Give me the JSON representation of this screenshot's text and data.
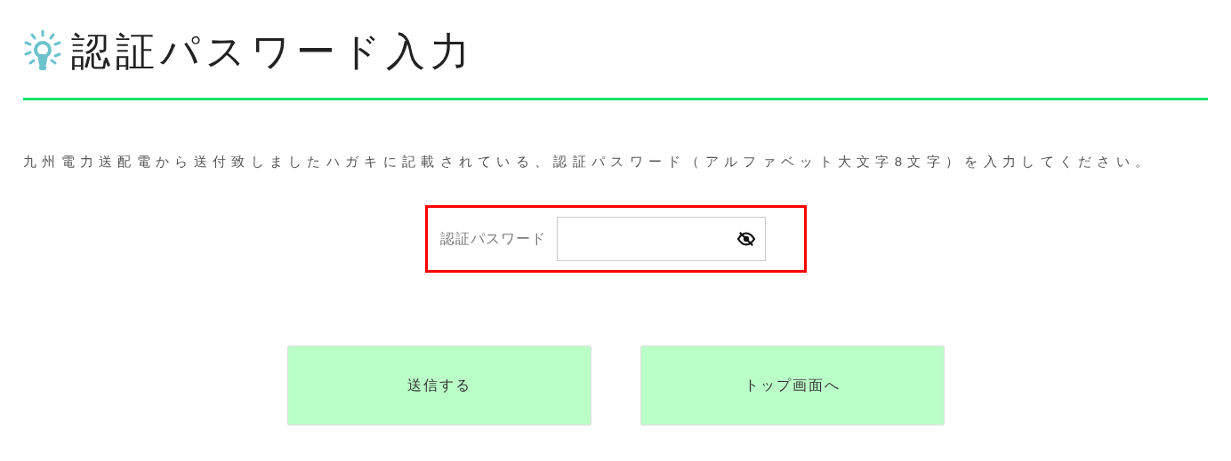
{
  "heading": {
    "title": "認証パスワード入力"
  },
  "instruction": "九州電力送配電から送付致しましたハガキに記載されている、認証パスワード（アルファベット大文字8文字）を入力してください。",
  "password_field": {
    "label": "認証パスワード",
    "highlighted": true,
    "masked": true
  },
  "buttons": [
    {
      "label": "送信する"
    },
    {
      "label": "トップ画面へ"
    }
  ]
}
